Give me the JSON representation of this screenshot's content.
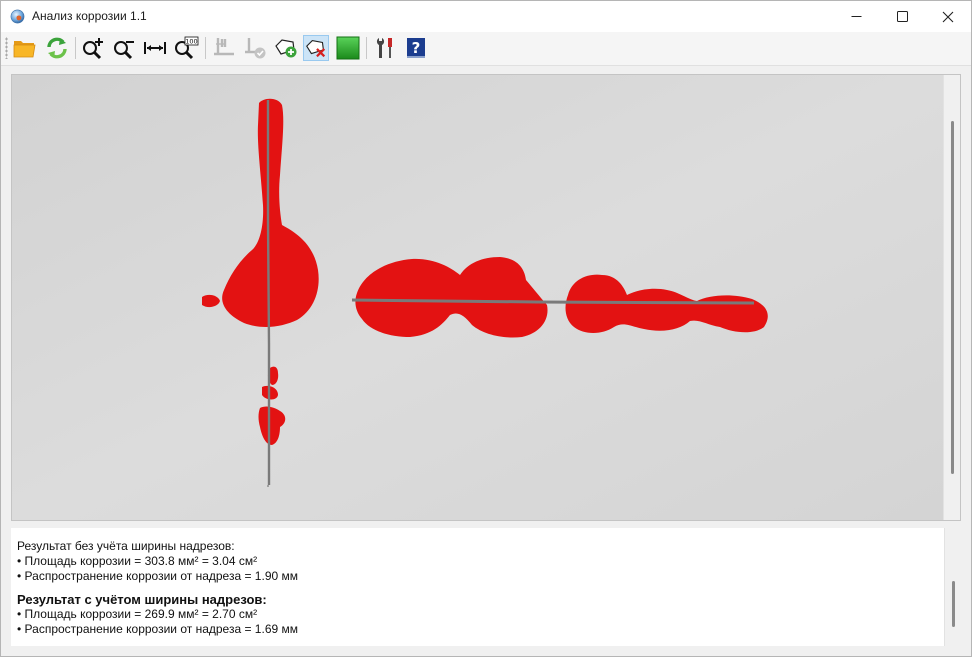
{
  "window": {
    "title": "Анализ коррозии 1.1"
  },
  "titlebar": {
    "minimize_icon": "minimize-icon",
    "maximize_icon": "maximize-icon",
    "close_icon": "close-icon"
  },
  "toolbar": {
    "buttons": [
      {
        "icon": "open-folder-icon"
      },
      {
        "icon": "refresh-icon"
      },
      {
        "icon": "zoom-in-icon"
      },
      {
        "icon": "zoom-out-icon"
      },
      {
        "icon": "fit-width-icon"
      },
      {
        "icon": "zoom-100-icon",
        "badge": "100"
      },
      {
        "icon": "scratch-ruler-icon",
        "disabled": true
      },
      {
        "icon": "scratch-ruler-check-icon",
        "disabled": true
      },
      {
        "icon": "add-polygon-icon"
      },
      {
        "icon": "delete-polygon-icon",
        "pressed": true
      },
      {
        "icon": "color-select-icon"
      },
      {
        "icon": "tools-settings-icon"
      },
      {
        "icon": "help-icon",
        "label": "?"
      }
    ]
  },
  "colors": {
    "corrosion": "#e31212",
    "panel": "#d8d8d8",
    "scratch": "#7a7a7a",
    "green_swatch": "#2fb02f",
    "help_blue": "#1c3d8f"
  },
  "results": {
    "section1_title": "Результат без учёта ширины надрезов:",
    "section1_area": "• Площадь коррозии = 303.8 мм² = 3.04 см²",
    "section1_spread": "• Распространение коррозии от надреза = 1.90 мм",
    "section2_title": "Результат с учётом ширины надрезов:",
    "section2_area": "• Площадь коррозии = 269.9 мм² = 2.70 см²",
    "section2_spread": "• Распространение коррозии от надреза = 1.69 мм"
  }
}
